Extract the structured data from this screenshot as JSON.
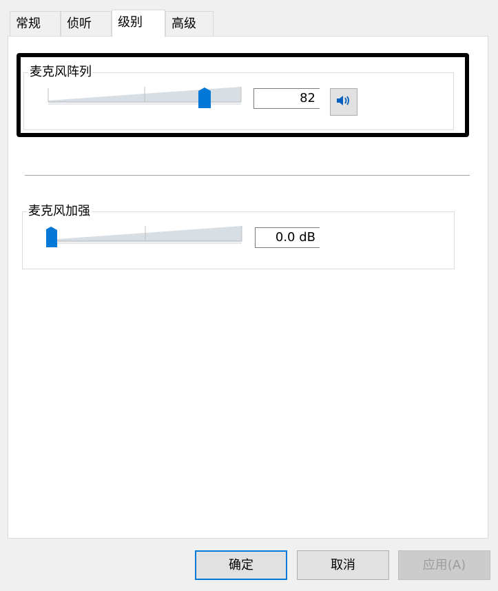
{
  "tabs": [
    {
      "label": "常规"
    },
    {
      "label": "侦听"
    },
    {
      "label": "级别"
    },
    {
      "label": "高级"
    }
  ],
  "active_tab": "级别",
  "mic_array": {
    "label": "麦克风阵列",
    "value": "82",
    "level_percent": 82
  },
  "mic_boost": {
    "label": "麦克风加强",
    "value": "0.0 dB",
    "level_percent": 0
  },
  "buttons": {
    "ok": "确定",
    "cancel": "取消",
    "apply": "应用(A)"
  },
  "colors": {
    "accent": "#0078d7",
    "highlight_border": "#000000"
  }
}
